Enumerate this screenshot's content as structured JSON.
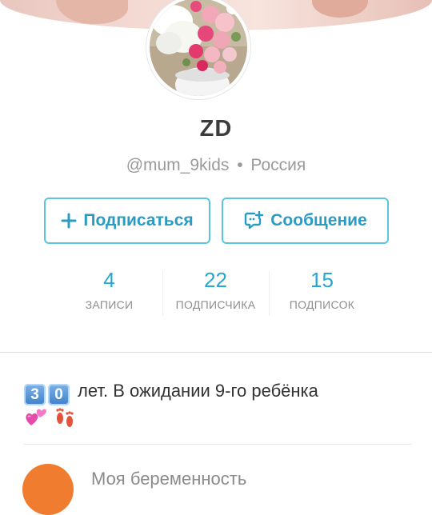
{
  "profile": {
    "name": "ZD",
    "handle": "@mum_9kids",
    "separator": "•",
    "location": "Россия"
  },
  "actions": {
    "follow_label": "Подписаться",
    "message_label": "Сообщение"
  },
  "stats": [
    {
      "value": "4",
      "label": "ЗАПИСИ"
    },
    {
      "value": "22",
      "label": "ПОДПИСЧИКА"
    },
    {
      "value": "15",
      "label": "ПОДПИСОК"
    }
  ],
  "bio": {
    "digit_1": "3",
    "digit_2": "0",
    "text": "лет. В ожидании 9-го ребёнка",
    "emojis": [
      "two-hearts-emoji",
      "footprints-emoji"
    ]
  },
  "next_item": {
    "label": "Моя беременность"
  },
  "colors": {
    "accent": "#2ba7cf",
    "button_border": "#5bc4e0",
    "orange": "#f07d2f"
  },
  "icons": [
    "plus-icon",
    "message-add-icon"
  ]
}
